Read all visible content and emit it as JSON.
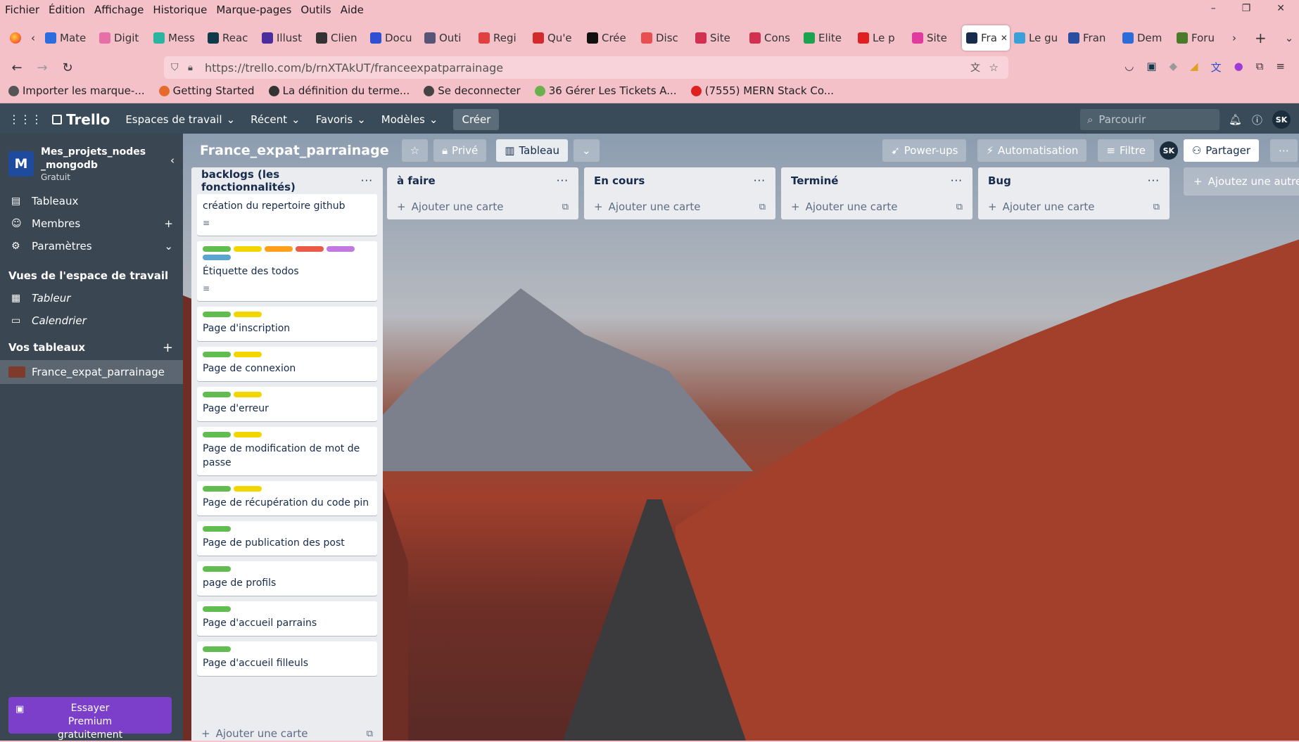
{
  "browser": {
    "menu": [
      "Fichier",
      "Édition",
      "Affichage",
      "Historique",
      "Marque-pages",
      "Outils",
      "Aide"
    ],
    "tabs": [
      {
        "label": "Mate",
        "color": "#2d6cdf"
      },
      {
        "label": "Digit",
        "color": "#e86ea8"
      },
      {
        "label": "Mess",
        "color": "#2bb5a1"
      },
      {
        "label": "Reac",
        "color": "#0e3b4a"
      },
      {
        "label": "Illust",
        "color": "#4b2d9e"
      },
      {
        "label": "Clien",
        "color": "#333333"
      },
      {
        "label": "Docu",
        "color": "#2d4fd1"
      },
      {
        "label": "Outi",
        "color": "#555577"
      },
      {
        "label": "Regi",
        "color": "#e04040"
      },
      {
        "label": "Qu'e",
        "color": "#d22b2b"
      },
      {
        "label": "Crée",
        "color": "#111111"
      },
      {
        "label": "Disc",
        "color": "#e85050"
      },
      {
        "label": "Site",
        "color": "#d23050"
      },
      {
        "label": "Cons",
        "color": "#d23050"
      },
      {
        "label": "Elite",
        "color": "#1ba34f"
      },
      {
        "label": "Le p",
        "color": "#e02020"
      },
      {
        "label": "Site",
        "color": "#e03ca0"
      },
      {
        "label": "Fra",
        "color": "#172b4d",
        "active": true
      },
      {
        "label": "Le gu",
        "color": "#3aa0d8"
      },
      {
        "label": "Fran",
        "color": "#2b4ea0"
      },
      {
        "label": "Dem",
        "color": "#2b6cd8"
      },
      {
        "label": "Foru",
        "color": "#4a7a2a"
      }
    ],
    "url": "https://trello.com/b/rnXTAkUT/franceexpatparrainage",
    "bookmarks": [
      {
        "label": "Importer les marque-...",
        "color": "#555"
      },
      {
        "label": "Getting Started",
        "color": "#e66a2c"
      },
      {
        "label": "La définition du terme...",
        "color": "#333"
      },
      {
        "label": "Se deconnecter",
        "color": "#444"
      },
      {
        "label": "36 Gérer Les Tickets A...",
        "color": "#6ab04c"
      },
      {
        "label": "(7555) MERN Stack Co...",
        "color": "#e02020"
      }
    ]
  },
  "trello": {
    "logo": "Trello",
    "nav": [
      "Espaces de travail",
      "Récent",
      "Favoris",
      "Modèles"
    ],
    "create": "Créer",
    "search_placeholder": "Parcourir",
    "avatar": "SK"
  },
  "sidebar": {
    "workspace_name": "Mes_projets_nodes_mongodb",
    "workspace_initial": "M",
    "plan": "Gratuit",
    "items": [
      "Tableaux",
      "Membres",
      "Paramètres"
    ],
    "views_title": "Vues de l'espace de travail",
    "views": [
      "Tableur",
      "Calendrier"
    ],
    "boards_title": "Vos tableaux",
    "boards": [
      "France_expat_parrainage"
    ],
    "premium": "Essayer Premium gratuitement"
  },
  "board": {
    "name": "France_expat_parrainage",
    "visibility": "Privé",
    "view": "Tableau",
    "powerups": "Power-ups",
    "automation": "Automatisation",
    "filter": "Filtre",
    "share": "Partager",
    "add_list": "Ajoutez une autre liste",
    "add_card": "Ajouter une carte"
  },
  "label_colors": {
    "green": "#61bd4f",
    "yellow": "#f2d600",
    "orange": "#ff9f1a",
    "red": "#eb5a46",
    "purple": "#c377e0",
    "blue": "#0079bf",
    "sky": "#5ba4cf"
  },
  "lists": [
    {
      "title": "backlogs (les fonctionnalités)",
      "cards": [
        {
          "title": "création du repertoire github",
          "labels": [],
          "desc": true
        },
        {
          "title": "Étiquette des todos",
          "labels": [
            "#61bd4f",
            "#f2d600",
            "#ff9f1a",
            "#eb5a46",
            "#c377e0",
            "#5ba4cf"
          ],
          "desc": true
        },
        {
          "title": "Page d'inscription",
          "labels": [
            "#61bd4f",
            "#f2d600"
          ]
        },
        {
          "title": "Page de connexion",
          "labels": [
            "#61bd4f",
            "#f2d600"
          ]
        },
        {
          "title": "Page d'erreur",
          "labels": [
            "#61bd4f",
            "#f2d600"
          ]
        },
        {
          "title": "Page de modification de mot de passe",
          "labels": [
            "#61bd4f",
            "#f2d600"
          ]
        },
        {
          "title": "Page de récupération du code pin",
          "labels": [
            "#61bd4f",
            "#f2d600"
          ]
        },
        {
          "title": "Page de publication des post",
          "labels": [
            "#61bd4f"
          ]
        },
        {
          "title": "page de profils",
          "labels": [
            "#61bd4f"
          ]
        },
        {
          "title": "Page d'accueil parrains",
          "labels": [
            "#61bd4f"
          ]
        },
        {
          "title": "Page d'accueil filleuls",
          "labels": [
            "#61bd4f"
          ]
        }
      ]
    },
    {
      "title": "à faire",
      "cards": []
    },
    {
      "title": "En cours",
      "cards": []
    },
    {
      "title": "Terminé",
      "cards": []
    },
    {
      "title": "Bug",
      "cards": []
    }
  ]
}
